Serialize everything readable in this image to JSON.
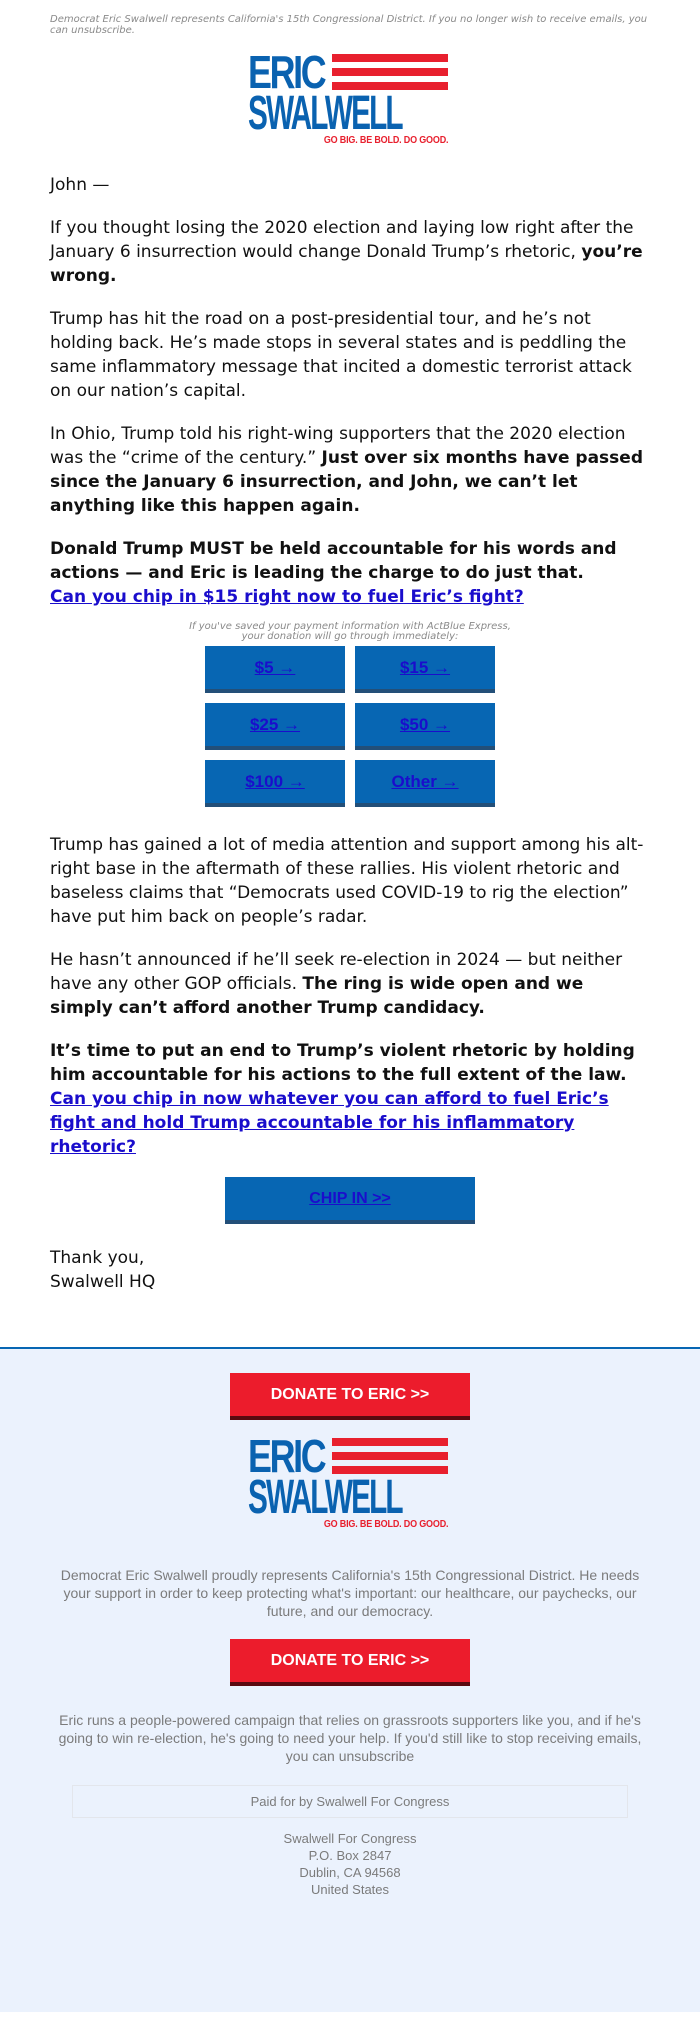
{
  "preheader": "Democrat Eric Swalwell represents California's 15th Congressional District. If you no longer wish to receive emails, you can unsubscribe.",
  "logo": {
    "line1": "ERIC",
    "line2": "SWALWELL",
    "tagline": "GO BIG. BE BOLD. DO GOOD.",
    "colors": {
      "blue": "#0a62b0",
      "red": "#e8202e"
    }
  },
  "body": {
    "greeting": "John —",
    "p1": {
      "text": "If you thought losing the 2020 election and laying low right after the January 6 insurrection would change Donald Trump’s rhetoric, ",
      "bold": "you’re wrong."
    },
    "p2": "Trump has hit the road on a post-presidential tour, and he’s not holding back. He’s made stops in several states and is peddling the same inflammatory message that incited a domestic terrorist attack on our nation’s capital.",
    "p3": {
      "text": "In Ohio, Trump told his right-wing supporters that the 2020 election was the “crime of the century.” ",
      "bold": "Just over six months have passed since the January 6 insurrection, and John, we can’t let anything like this happen again."
    },
    "p4": {
      "bold": "Donald Trump MUST be held accountable for his words and actions — and Eric is leading the charge to do just that.",
      "link": "Can you chip in $15 right now to fuel Eric’s fight?"
    },
    "express_note_line1": "If you've saved your payment information with ActBlue Express,",
    "express_note_line2": "your donation will go through immediately:",
    "amounts": [
      "$5 →",
      "$15 →",
      "$25 →",
      "$50 →",
      "$100 →",
      "Other →"
    ],
    "p5": "Trump has gained a lot of media attention and support among his alt-right base in the aftermath of these rallies. His violent rhetoric and baseless claims that “Democrats used COVID-19 to rig the election” have put him back on people’s radar.",
    "p6": {
      "text": "He hasn’t announced if he’ll seek re-election in 2024 — but neither have any other GOP officials. ",
      "bold": "The ring is wide open and we simply can’t afford another Trump candidacy."
    },
    "p7": {
      "bold": "It’s time to put an end to Trump’s violent rhetoric by holding him accountable for his actions to the full extent of the law.",
      "link": "Can you chip in now whatever you can afford to fuel Eric’s fight and hold Trump accountable for his inflammatory rhetoric?"
    },
    "chip_in_label": "CHIP IN >>",
    "signoff_line1": "Thank you,",
    "signoff_line2": "Swalwell HQ"
  },
  "footer": {
    "donate_label": "DONATE TO ERIC >>",
    "about": "Democrat Eric Swalwell proudly represents California's 15th Congressional District. He needs your support in order to keep protecting what's important: our healthcare, our paychecks, our future, and our democracy.",
    "grassroots": "Eric runs a people-powered campaign that relies on grassroots supporters like you, and if he's going to win re-election, he's going to need your help. If you'd still like to stop receiving emails, you can unsubscribe",
    "paid_for": "Paid for by Swalwell For Congress",
    "address": [
      "Swalwell For Congress",
      "P.O. Box 2847",
      "Dublin, CA 94568",
      "United States"
    ]
  },
  "colors": {
    "button_blue": "#0766b3",
    "button_red": "#ec1c2c",
    "link": "#1a0dcc",
    "footer_bg": "#ebf2fd"
  }
}
